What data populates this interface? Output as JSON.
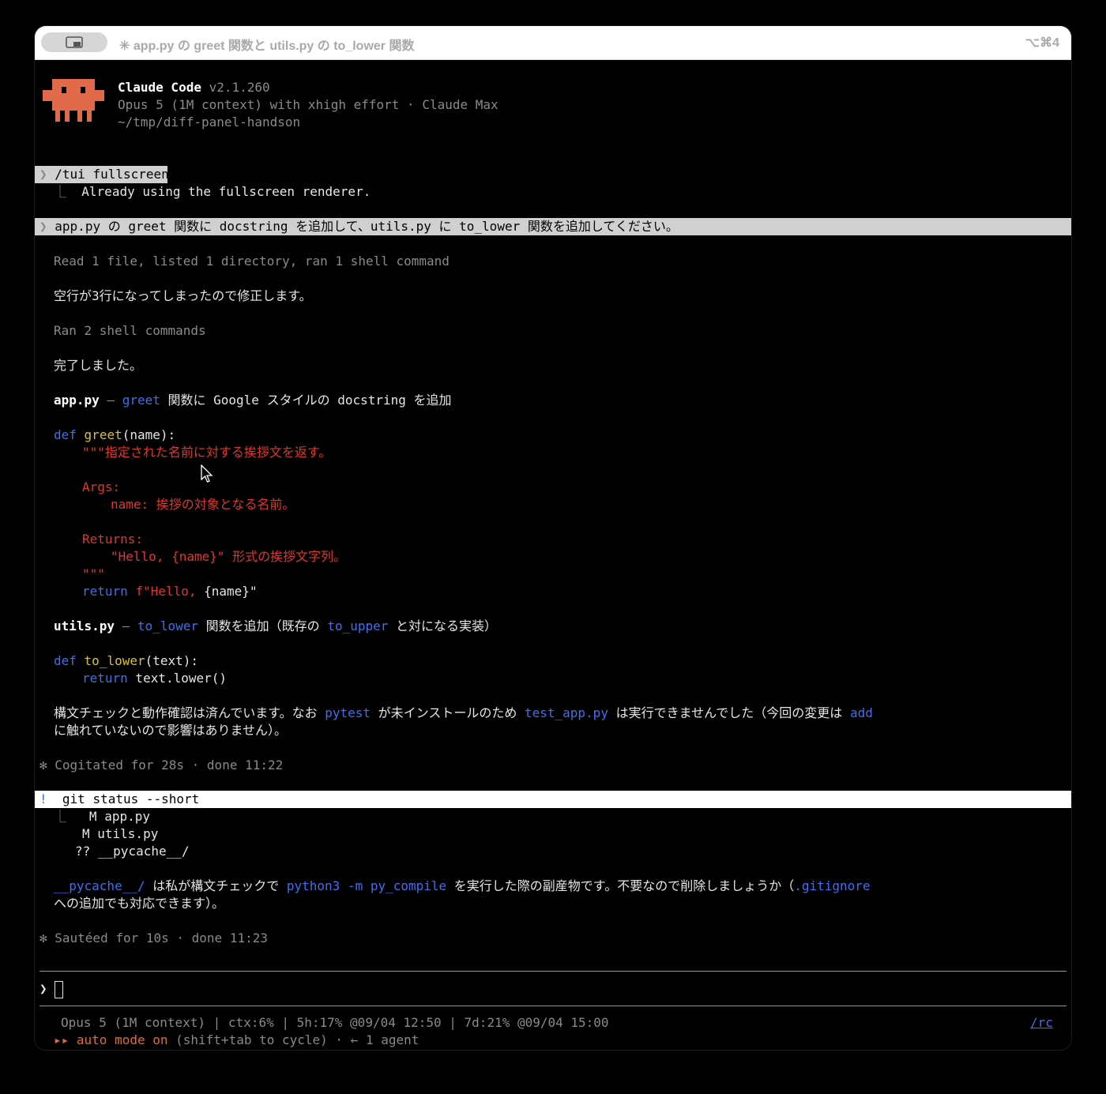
{
  "window": {
    "title": "✳ app.py の greet 関数と utils.py の to_lower 関数",
    "shortcut": "⌥⌘4",
    "tab_icon": "window-tab-icon"
  },
  "banner": {
    "app_name": "Claude Code",
    "version": "v2.1.260",
    "model_line": "Opus 5 (1M context) with xhigh effort · Claude Max",
    "path": "~/tmp/diff-panel-handson",
    "logo": "claude-mascot-icon",
    "logo_color": "#e06a4a"
  },
  "transcript": {
    "cmd1_prompt": "❯",
    "cmd1": "/tui fullscreen",
    "cmd1_reply_branch": "⎿",
    "cmd1_reply": "Already using the fullscreen renderer.",
    "user_prompt": "❯",
    "user_msg": "app.py の greet 関数に docstring を追加して、utils.py に to_lower 関数を追加してください。",
    "tool_summary1": "Read 1 file, listed 1 directory, ran 1 shell command",
    "fix_msg": "空行が3行になってしまったので修正します。",
    "tool_summary2": "Ran 2 shell commands",
    "done_msg": "完了しました。",
    "app_heading": {
      "file": "app.py",
      "dash": " – ",
      "func": "greet",
      "rest": " 関数に Google スタイルの docstring を追加"
    },
    "code1": {
      "kw_def": "def",
      "fn_name": "greet",
      "sig": "(name):",
      "doc1": "\"\"\"指定された名前に対する挨拶文を返す。",
      "args": "Args:",
      "arg_name": "name: 挨拶の対象となる名前。",
      "returns": "Returns:",
      "ret_desc": "\"Hello, {name}\" 形式の挨拶文字列。",
      "doc_end": "\"\"\"",
      "kw_return": "return",
      "ret_str": "f\"Hello, ",
      "ret_rest": "{name}\""
    },
    "utils_heading": {
      "file": "utils.py",
      "dash": " – ",
      "func": "to_lower",
      "mid": " 関数を追加（既存の ",
      "func2": "to_upper",
      "rest": " と対になる実装）"
    },
    "code2": {
      "kw_def": "def",
      "fn_name": "to_lower",
      "sig": "(text):",
      "kw_return": "return",
      "ret_expr": " text.lower()"
    },
    "check_msg": {
      "p1": "構文チェックと動作確認は済んでいます。なお ",
      "pytest": "pytest",
      "p2": " が未インストールのため ",
      "test_file": "test_app.py",
      "p3": " は実行できませんでした（今回の変更は ",
      "add": "add",
      "line2": "に触れていないので影響はありません）。"
    },
    "status1": "✻ Cogitated for 28s · done 11:22",
    "bash_marker": "!",
    "bash_cmd": "git status --short",
    "bash_branch": "⎿",
    "bash_out1": "M app.py",
    "bash_out2": "M utils.py",
    "bash_out3": "?? __pycache__/",
    "pycache_msg": {
      "dir": "__pycache__/",
      "p1": " は私が構文チェックで ",
      "cmd": "python3 -m py_compile",
      "p2": " を実行した際の副産物です。不要なので削除しましょうか（",
      "gitignore": ".gitignore",
      "line2": "への追加でも対応できます）。"
    },
    "status2": "✻ Sautéed for 10s · done 11:23"
  },
  "input": {
    "prompt": "❯",
    "value": ""
  },
  "statusline": {
    "info": "Opus 5 (1M context) | ctx:6% | 5h:17% @09/04 12:50 | 7d:21% @09/04 15:00",
    "rc_link": "/rc",
    "mode_arrows": "▸▸",
    "mode_label": "auto mode on",
    "mode_hint": " (shift+tab to cycle) · ← 1 agent"
  }
}
